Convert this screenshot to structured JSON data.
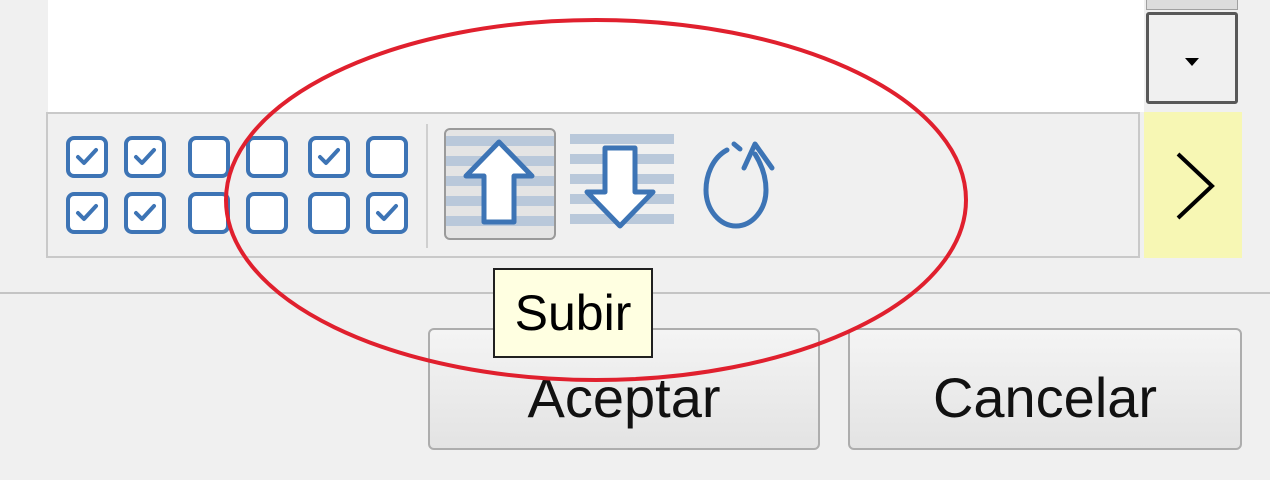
{
  "tooltip": {
    "text": "Subir"
  },
  "dialog": {
    "ok_label": "Aceptar",
    "cancel_label": "Cancelar"
  },
  "toolbar": {
    "checkbox_grid": [
      [
        true,
        true,
        false,
        false,
        true,
        false
      ],
      [
        true,
        true,
        false,
        false,
        false,
        true
      ]
    ],
    "tools": [
      "arrow-up-icon",
      "arrow-down-icon",
      "reset-icon"
    ],
    "active_tool": "arrow-up-icon"
  },
  "colors": {
    "icon_blue": "#3d74b5",
    "annotation_red": "#e0202e",
    "tooltip_bg": "#ffffe1",
    "next_button_bg": "#f7f7b4"
  }
}
